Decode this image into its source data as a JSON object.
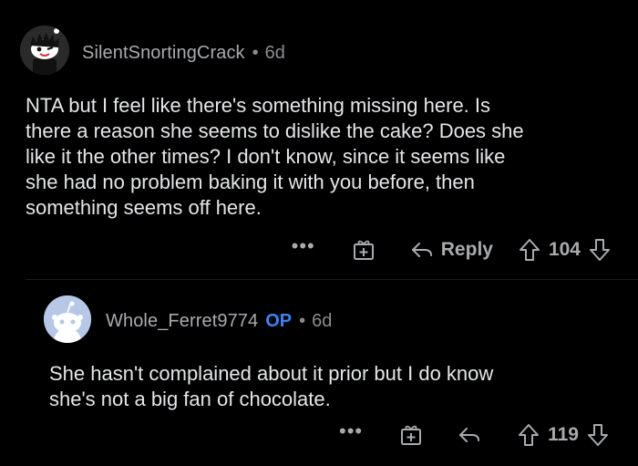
{
  "comments": [
    {
      "username": "SilentSnortingCrack",
      "separator": "•",
      "age": "6d",
      "avatar_icon": "snoo-avatar-icon",
      "body": "NTA but I feel like there's something missing here. Is\nthere a reason she seems to dislike the cake? Does she\nlike it the other times? I don't know, since it seems like\nshe had no problem baking it with you before, then\nsomething seems off here.",
      "actions": {
        "more": "•••",
        "award_icon": "award-icon",
        "reply_icon": "reply-arrow-icon",
        "reply_label": "Reply",
        "upvote_icon": "upvote-arrow-icon",
        "score": "104",
        "downvote_icon": "downvote-arrow-icon"
      }
    },
    {
      "username": "Whole_Ferret9774",
      "op_badge": "OP",
      "separator": "•",
      "age": "6d",
      "avatar_icon": "default-snoo-avatar-icon",
      "body": "She hasn't complained about it prior but I do know\nshe's not a big fan of chocolate.",
      "actions": {
        "more": "•••",
        "award_icon": "award-icon",
        "reply_icon": "reply-arrow-icon",
        "upvote_icon": "upvote-arrow-icon",
        "score": "119",
        "downvote_icon": "downvote-arrow-icon"
      }
    }
  ],
  "colors": {
    "background": "#000000",
    "text": "#e4e6e8",
    "muted": "#a8abae",
    "op_badge": "#3b82f6"
  }
}
